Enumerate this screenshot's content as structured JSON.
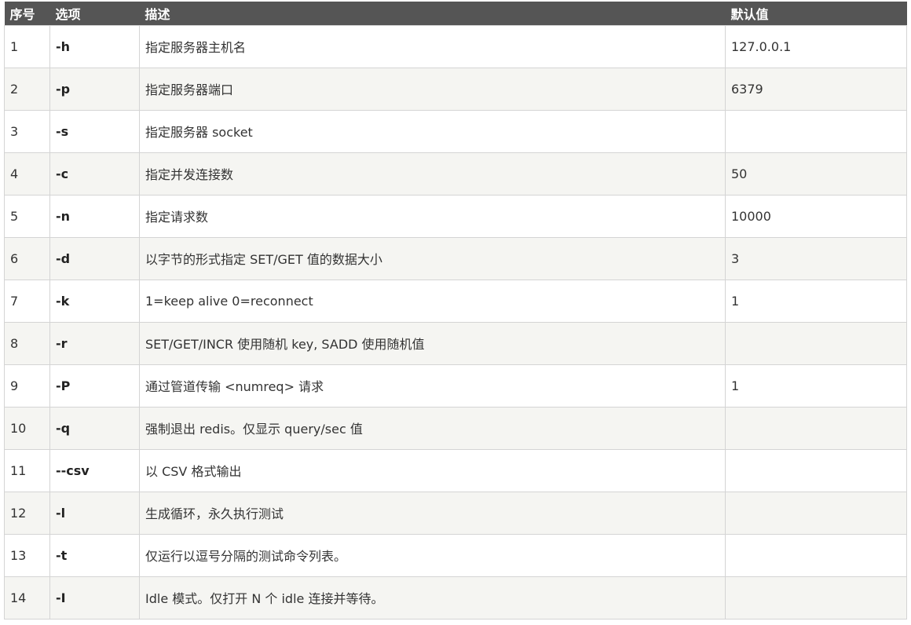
{
  "table": {
    "headers": {
      "num": "序号",
      "option": "选项",
      "description": "描述",
      "default": "默认值"
    },
    "rows": [
      {
        "num": "1",
        "option": "-h",
        "description": "指定服务器主机名",
        "default": "127.0.0.1"
      },
      {
        "num": "2",
        "option": "-p",
        "description": "指定服务器端口",
        "default": "6379"
      },
      {
        "num": "3",
        "option": "-s",
        "description": "指定服务器 socket",
        "default": ""
      },
      {
        "num": "4",
        "option": "-c",
        "description": "指定并发连接数",
        "default": "50"
      },
      {
        "num": "5",
        "option": "-n",
        "description": "指定请求数",
        "default": "10000"
      },
      {
        "num": "6",
        "option": "-d",
        "description": "以字节的形式指定 SET/GET 值的数据大小",
        "default": "3"
      },
      {
        "num": "7",
        "option": "-k",
        "description": "1=keep alive 0=reconnect",
        "default": "1"
      },
      {
        "num": "8",
        "option": "-r",
        "description": "SET/GET/INCR 使用随机 key, SADD 使用随机值",
        "default": ""
      },
      {
        "num": "9",
        "option": "-P",
        "description": "通过管道传输 <numreq> 请求",
        "default": "1"
      },
      {
        "num": "10",
        "option": "-q",
        "description": "强制退出 redis。仅显示 query/sec 值",
        "default": ""
      },
      {
        "num": "11",
        "option": "--csv",
        "description": "以 CSV 格式输出",
        "default": ""
      },
      {
        "num": "12",
        "option": "-l",
        "description": "生成循环，永久执行测试",
        "default": ""
      },
      {
        "num": "13",
        "option": "-t",
        "description": "仅运行以逗号分隔的测试命令列表。",
        "default": ""
      },
      {
        "num": "14",
        "option": "-I",
        "description": "Idle 模式。仅打开 N 个 idle 连接并等待。",
        "default": ""
      }
    ]
  }
}
